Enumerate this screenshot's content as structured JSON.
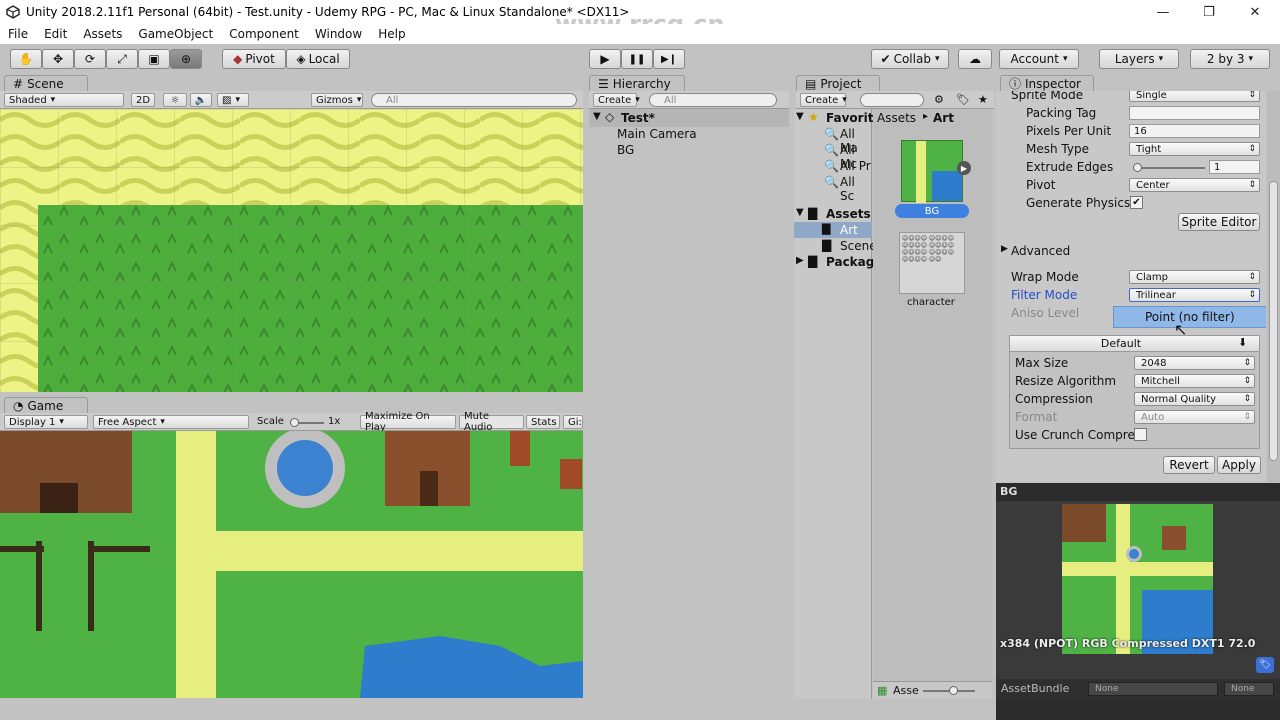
{
  "window": {
    "title": "Unity 2018.2.11f1 Personal (64bit) - Test.unity - Udemy RPG - PC, Mac & Linux Standalone* <DX11>",
    "watermark": "www.rrcg.cn",
    "controls": {
      "minimize": "—",
      "restore": "❐",
      "close": "✕"
    }
  },
  "menu": [
    "File",
    "Edit",
    "Assets",
    "GameObject",
    "Component",
    "Window",
    "Help"
  ],
  "toolbar": {
    "pivot": "Pivot",
    "local": "Local",
    "collab": "Collab",
    "account": "Account",
    "layers": "Layers",
    "layout": "2 by 3",
    "play_icon": "▶",
    "pause_icon": "❚❚",
    "step_icon": "▶❙"
  },
  "scene": {
    "tab": "Scene",
    "shading": "Shaded",
    "mode_2d": "2D",
    "gizmos": "Gizmos",
    "search_placeholder": "All"
  },
  "game": {
    "tab": "Game",
    "display": "Display 1",
    "aspect": "Free Aspect",
    "scale_label": "Scale",
    "scale_value": "1x",
    "maximize": "Maximize On Play",
    "mute": "Mute Audio",
    "stats": "Stats",
    "gizmos": "Gi:"
  },
  "hierarchy": {
    "tab": "Hierarchy",
    "create": "Create",
    "search_placeholder": "All",
    "scene_name": "Test*",
    "items": [
      "Main Camera",
      "BG"
    ]
  },
  "project": {
    "tab": "Project",
    "create": "Create",
    "tree": {
      "favorites": "Favorit",
      "fav_items": [
        "All Ma",
        "All Mc",
        "All Pr",
        "All Sc"
      ],
      "assets": "Assets",
      "asset_items": [
        "Art",
        "Scene"
      ],
      "packages": "Packag"
    },
    "breadcrumb": [
      "Assets",
      "Art"
    ],
    "files": [
      {
        "name": "BG",
        "selected": true
      },
      {
        "name": "character",
        "selected": false
      }
    ],
    "footer": "Asse"
  },
  "inspector": {
    "tab": "Inspector",
    "sprite_mode_label": "Sprite Mode",
    "sprite_mode_value": "Single",
    "packing_tag_label": "Packing Tag",
    "packing_tag_value": "",
    "ppu_label": "Pixels Per Unit",
    "ppu_value": "16",
    "mesh_type_label": "Mesh Type",
    "mesh_type_value": "Tight",
    "extrude_label": "Extrude Edges",
    "extrude_value": "1",
    "pivot_label": "Pivot",
    "pivot_value": "Center",
    "physics_label": "Generate Physics",
    "physics_checked": true,
    "sprite_editor": "Sprite Editor",
    "advanced": "Advanced",
    "wrap_label": "Wrap Mode",
    "wrap_value": "Clamp",
    "filter_label": "Filter Mode",
    "filter_value": "Trilinear",
    "aniso_label": "Aniso Level",
    "dropdown_option": "Point (no filter)",
    "platform_tab": "Default",
    "max_size_label": "Max Size",
    "max_size_value": "2048",
    "resize_label": "Resize Algorithm",
    "resize_value": "Mitchell",
    "compression_label": "Compression",
    "compression_value": "Normal Quality",
    "format_label": "Format",
    "format_value": "Auto",
    "crunch_label": "Use Crunch Compre",
    "revert": "Revert",
    "apply": "Apply"
  },
  "preview": {
    "title": "BG",
    "info": "x384 (NPOT)  RGB Compressed DXT1   72.0",
    "assetbundle_label": "AssetBundle",
    "assetbundle_value": "None",
    "variant_value": "None"
  },
  "colors": {
    "selection": "#3d80df",
    "grass": "#4caa3a",
    "sand": "#e8f07a",
    "water": "#2e7ccc",
    "highlight": "#8fb8e8"
  }
}
